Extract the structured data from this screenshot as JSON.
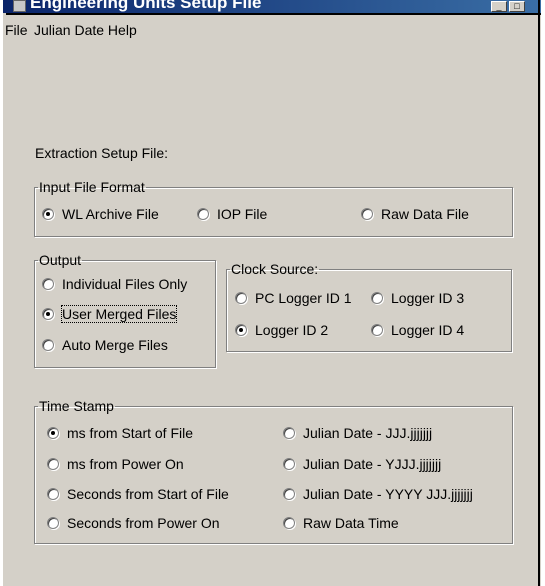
{
  "window": {
    "title": "Engineering Units Setup File",
    "minimize_glyph": "_",
    "maximize_glyph": "□"
  },
  "menu": [
    "File",
    "Julian Date Help"
  ],
  "extraction_label": "Extraction Setup File:",
  "input_format": {
    "legend": "Input File Format",
    "options": [
      {
        "label": "WL Archive File",
        "selected": true
      },
      {
        "label": "IOP File",
        "selected": false
      },
      {
        "label": "Raw Data File",
        "selected": false
      }
    ]
  },
  "output": {
    "legend": "Output",
    "options": [
      {
        "label": "Individual Files Only",
        "selected": false
      },
      {
        "label": "User Merged Files",
        "selected": true
      },
      {
        "label": "Auto Merge Files",
        "selected": false
      }
    ]
  },
  "clock_source": {
    "legend": "Clock Source:",
    "options": [
      {
        "label": "PC Logger ID 1",
        "selected": false
      },
      {
        "label": "Logger ID 3",
        "selected": false
      },
      {
        "label": "Logger ID 2",
        "selected": true
      },
      {
        "label": "Logger ID 4",
        "selected": false
      }
    ]
  },
  "time_stamp": {
    "legend": "Time Stamp",
    "options": [
      {
        "label": "ms from Start of File",
        "selected": true
      },
      {
        "label": "Julian Date - JJJ.jjjjjjj",
        "selected": false
      },
      {
        "label": "ms from Power On",
        "selected": false
      },
      {
        "label": "Julian Date - YJJJ.jjjjjjj",
        "selected": false
      },
      {
        "label": "Seconds from Start of File",
        "selected": false
      },
      {
        "label": "Julian Date - YYYY JJJ.jjjjjjj",
        "selected": false
      },
      {
        "label": "Seconds from Power On",
        "selected": false
      },
      {
        "label": "Raw Data Time",
        "selected": false
      }
    ]
  }
}
